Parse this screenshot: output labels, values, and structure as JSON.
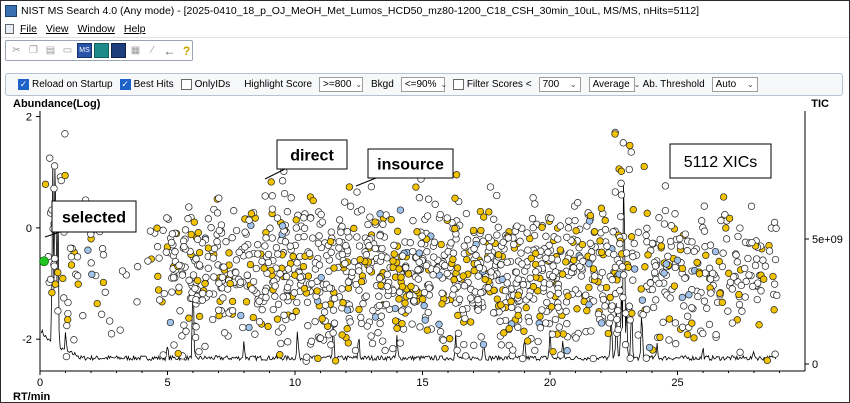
{
  "window": {
    "title": "NIST MS Search 4.0 (Any mode) - [2025-0410_18_p_OJ_MeOH_Met_Lumos_HCD50_mz80-1200_C18_CSH_30min_10uL, MS/MS, nHits=5112]"
  },
  "menu": {
    "items": [
      {
        "label": "File",
        "name": "menu-file"
      },
      {
        "label": "View",
        "name": "menu-view"
      },
      {
        "label": "Window",
        "name": "menu-window"
      },
      {
        "label": "Help",
        "name": "menu-help"
      }
    ]
  },
  "toolbar": {
    "icons": [
      "cut-icon",
      "copy-icon",
      "paste-icon",
      "print-icon",
      "ms-search-icon",
      "spectrum-icon",
      "compare-icon",
      "table-icon",
      "mz-icon",
      "back-arrow-icon",
      "help-icon"
    ]
  },
  "filters": {
    "reload_on_startup": {
      "label": "Reload on Startup",
      "checked": true
    },
    "best_hits": {
      "label": "Best Hits",
      "checked": true
    },
    "only_ids": {
      "label": "OnlyIDs",
      "checked": false
    },
    "highlight_score": {
      "label": "Highlight Score",
      "value": ">=800"
    },
    "bkgd": {
      "label": "Bkgd",
      "value": "<=90%"
    },
    "filter_scores": {
      "label": "Filter Scores <",
      "checked": false,
      "value": "700"
    },
    "average": {
      "value": "Average"
    },
    "ab_threshold": {
      "label": "Ab. Threshold",
      "value": "Auto"
    }
  },
  "chart_data": {
    "type": "scatter",
    "ylabel_left": "Abundance(Log)",
    "ylabel_right": "TIC",
    "xlabel": "RT/min",
    "xlim": [
      0,
      30
    ],
    "ylim_left": [
      -2.5,
      2.1
    ],
    "left_ticks": [
      "2",
      "0",
      "-2"
    ],
    "left_tick_values": [
      2,
      0,
      -2
    ],
    "right_ticks": [
      "5e+09",
      "0"
    ],
    "x_ticks": [
      "0",
      "5",
      "10",
      "15",
      "20",
      "25"
    ],
    "x_tick_values": [
      0,
      5,
      10,
      15,
      20,
      25
    ],
    "hits_label": "5112 XICs",
    "colors": {
      "default": "#ffffff",
      "high_score": "#f2c300",
      "insource": "#9fc3ea",
      "selected": "#22c422",
      "tic": "#000000"
    },
    "annotations": [
      {
        "text": "direct",
        "x": 9.0,
        "y": 0.8
      },
      {
        "text": "insource",
        "x": 12.8,
        "y": 0.6
      },
      {
        "text": "selected",
        "x": 0.12,
        "y": -0.6
      }
    ],
    "selected_point": {
      "x": 0.12,
      "y": -0.6
    },
    "density_profile": [
      [
        0,
        0.3
      ],
      [
        1,
        0.45
      ],
      [
        2,
        0.3
      ],
      [
        3,
        0.1
      ],
      [
        4,
        0.12
      ],
      [
        5,
        0.7
      ],
      [
        6,
        0.85
      ],
      [
        7,
        0.8
      ],
      [
        8,
        0.85
      ],
      [
        9,
        0.9
      ],
      [
        10,
        0.9
      ],
      [
        11,
        0.95
      ],
      [
        12,
        0.95
      ],
      [
        13,
        0.95
      ],
      [
        14,
        0.95
      ],
      [
        15,
        0.95
      ],
      [
        16,
        0.9
      ],
      [
        17,
        0.9
      ],
      [
        18,
        0.9
      ],
      [
        19,
        0.9
      ],
      [
        20,
        0.9
      ],
      [
        21,
        0.95
      ],
      [
        22,
        0.95
      ],
      [
        23,
        0.9
      ],
      [
        24,
        0.8
      ],
      [
        25,
        0.7
      ],
      [
        26,
        0.6
      ],
      [
        27,
        0.55
      ],
      [
        28,
        0.55
      ],
      [
        29,
        0.2
      ]
    ],
    "tic_peaks": [
      [
        0.5,
        0.75
      ],
      [
        0.6,
        0.9
      ],
      [
        0.7,
        0.6
      ],
      [
        1.0,
        0.08
      ],
      [
        5.0,
        0.05
      ],
      [
        6.0,
        0.35
      ],
      [
        8.0,
        0.07
      ],
      [
        10.1,
        0.12
      ],
      [
        11.5,
        0.15
      ],
      [
        12.5,
        0.1
      ],
      [
        14.0,
        0.09
      ],
      [
        16.3,
        0.1
      ],
      [
        17.4,
        0.08
      ],
      [
        19.0,
        0.09
      ],
      [
        20.0,
        0.12
      ],
      [
        20.5,
        0.07
      ],
      [
        22.4,
        0.2
      ],
      [
        22.6,
        0.24
      ],
      [
        22.8,
        0.3
      ],
      [
        22.9,
        0.88
      ],
      [
        23.0,
        0.22
      ],
      [
        23.2,
        0.25
      ],
      [
        23.6,
        0.2
      ],
      [
        24.2,
        0.06
      ],
      [
        26.0,
        0.04
      ],
      [
        28.0,
        0.03
      ]
    ]
  }
}
